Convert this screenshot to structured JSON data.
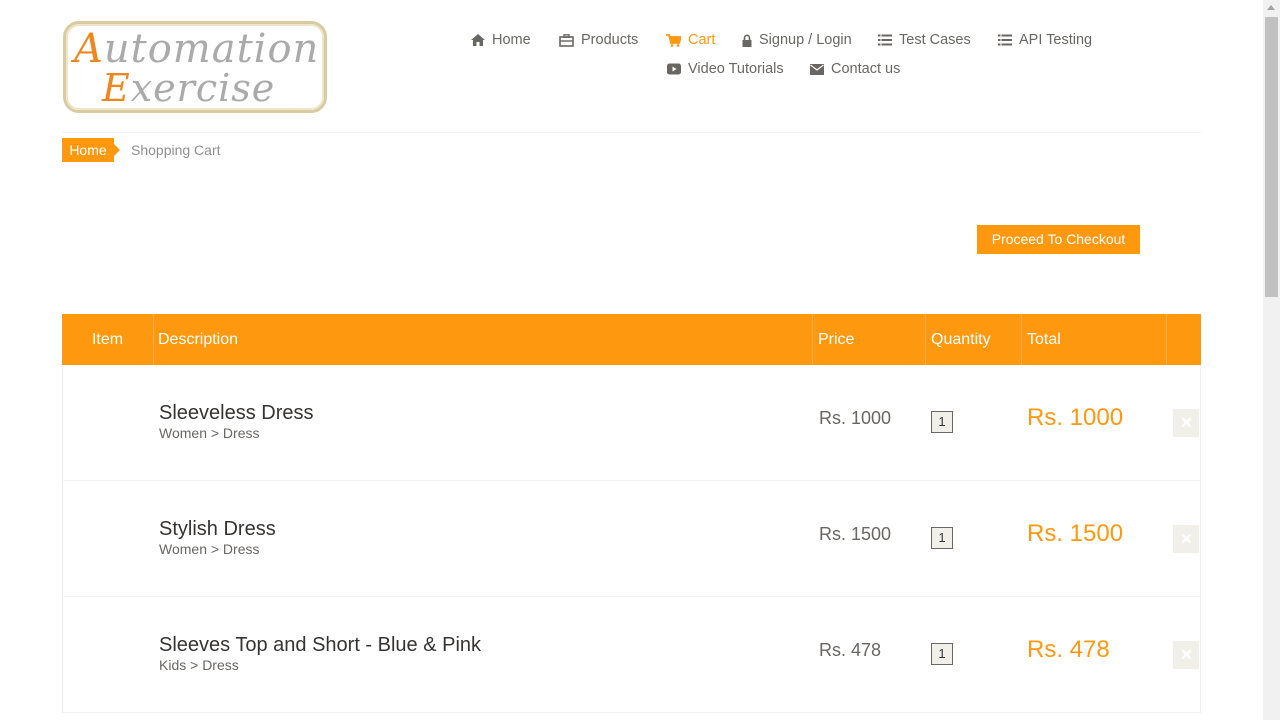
{
  "logo": {
    "line1_first": "A",
    "line1_rest": "utomation",
    "line2_first": "E",
    "line2_rest": "xercise"
  },
  "nav": {
    "items": [
      {
        "label": "Home",
        "icon": "home-icon"
      },
      {
        "label": "Products",
        "icon": "products-icon"
      },
      {
        "label": "Cart",
        "icon": "cart-icon",
        "active": true
      },
      {
        "label": "Signup / Login",
        "icon": "lock-icon"
      },
      {
        "label": "Test Cases",
        "icon": "list-icon"
      },
      {
        "label": "API Testing",
        "icon": "list-icon"
      },
      {
        "label": "Video Tutorials",
        "icon": "youtube-icon"
      },
      {
        "label": "Contact us",
        "icon": "envelope-icon"
      }
    ]
  },
  "breadcrumb": {
    "home": "Home",
    "current": "Shopping Cart"
  },
  "checkout_label": "Proceed To Checkout",
  "table": {
    "headers": [
      "Item",
      "Description",
      "Price",
      "Quantity",
      "Total"
    ],
    "rows": [
      {
        "name": "Sleeveless Dress",
        "category": "Women > Dress",
        "price": "Rs. 1000",
        "quantity": "1",
        "total": "Rs. 1000"
      },
      {
        "name": "Stylish Dress",
        "category": "Women > Dress",
        "price": "Rs. 1500",
        "quantity": "1",
        "total": "Rs. 1500"
      },
      {
        "name": "Sleeves Top and Short - Blue & Pink",
        "category": "Kids > Dress",
        "price": "Rs. 478",
        "quantity": "1",
        "total": "Rs. 478"
      }
    ]
  },
  "colors": {
    "accent": "#FE980F",
    "text": "#696763",
    "dark_text": "#363432",
    "delete_bg": "#F0F0E9"
  }
}
